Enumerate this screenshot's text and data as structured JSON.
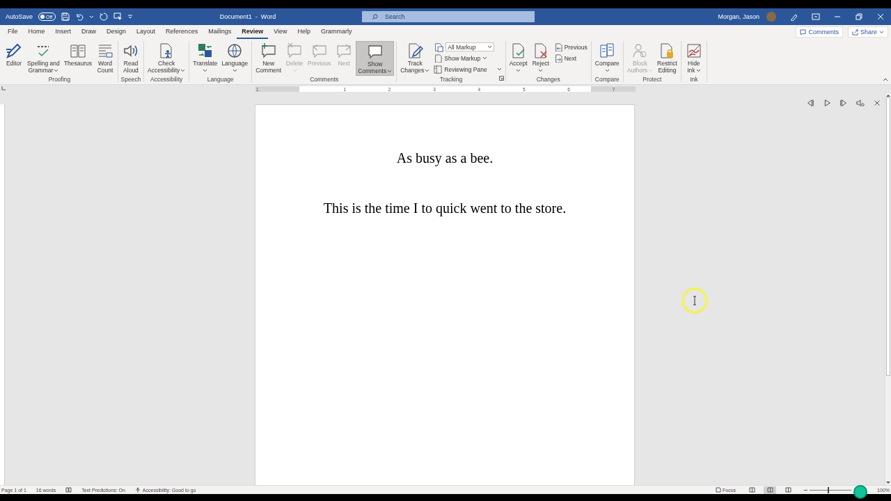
{
  "window": {
    "title": "Document1  -  Word"
  },
  "quick_access": {
    "autosave_label": "AutoSave",
    "autosave": {
      "on": false,
      "label": "Off"
    }
  },
  "search": {
    "placeholder": "Search"
  },
  "user": {
    "name": "Morgan, Jason"
  },
  "tabs": [
    {
      "label": "File",
      "selected": false
    },
    {
      "label": "Home",
      "selected": false
    },
    {
      "label": "Insert",
      "selected": false
    },
    {
      "label": "Draw",
      "selected": false
    },
    {
      "label": "Design",
      "selected": false
    },
    {
      "label": "Layout",
      "selected": false
    },
    {
      "label": "References",
      "selected": false
    },
    {
      "label": "Mailings",
      "selected": false
    },
    {
      "label": "Review",
      "selected": true
    },
    {
      "label": "View",
      "selected": false
    },
    {
      "label": "Help",
      "selected": false
    },
    {
      "label": "Grammarly",
      "selected": false
    }
  ],
  "header_buttons": [
    {
      "label": "Comments",
      "dropdown": false
    },
    {
      "label": "Share",
      "dropdown": true
    }
  ],
  "ribbon": {
    "groups": [
      {
        "name": "Proofing",
        "buttons": [
          {
            "kind": "large",
            "lines": [
              "Editor"
            ],
            "dropdown": false,
            "disabled": false,
            "pressed": false
          },
          {
            "kind": "large",
            "lines": [
              "Spelling and",
              "Grammar"
            ],
            "dropdown": true,
            "disabled": false,
            "pressed": false
          },
          {
            "kind": "large",
            "lines": [
              "Thesaurus"
            ],
            "dropdown": false,
            "disabled": false,
            "pressed": false
          },
          {
            "kind": "large",
            "lines": [
              "Word",
              "Count"
            ],
            "dropdown": false,
            "disabled": false,
            "pressed": false
          }
        ]
      },
      {
        "name": "Speech",
        "buttons": [
          {
            "kind": "large",
            "lines": [
              "Read",
              "Aloud"
            ],
            "dropdown": false,
            "disabled": false,
            "pressed": false
          }
        ]
      },
      {
        "name": "Accessibility",
        "buttons": [
          {
            "kind": "large",
            "lines": [
              "Check",
              "Accessibility"
            ],
            "dropdown": true,
            "disabled": false,
            "pressed": false
          }
        ]
      },
      {
        "name": "Language",
        "buttons": [
          {
            "kind": "large",
            "lines": [
              "Translate"
            ],
            "dropdown": true,
            "disabled": false,
            "pressed": false
          },
          {
            "kind": "large",
            "lines": [
              "Language"
            ],
            "dropdown": true,
            "disabled": false,
            "pressed": false
          }
        ]
      },
      {
        "name": "Comments",
        "buttons": [
          {
            "kind": "large",
            "lines": [
              "New",
              "Comment"
            ],
            "dropdown": false,
            "disabled": false,
            "pressed": false
          },
          {
            "kind": "large",
            "lines": [
              "Delete"
            ],
            "dropdown": true,
            "disabled": true,
            "pressed": false
          },
          {
            "kind": "large",
            "lines": [
              "Previous"
            ],
            "dropdown": false,
            "disabled": true,
            "pressed": false
          },
          {
            "kind": "large",
            "lines": [
              "Next"
            ],
            "dropdown": false,
            "disabled": true,
            "pressed": false
          },
          {
            "kind": "large",
            "lines": [
              "Show",
              "Comments"
            ],
            "dropdown": true,
            "disabled": false,
            "pressed": true
          }
        ]
      },
      {
        "name": "Tracking",
        "launcher": true,
        "buttons": [
          {
            "kind": "large",
            "lines": [
              "Track",
              "Changes"
            ],
            "dropdown": true,
            "disabled": false,
            "pressed": false
          },
          {
            "kind": "select",
            "lines": [
              "All Markup"
            ],
            "dropdown": true,
            "disabled": false,
            "pressed": false
          },
          {
            "kind": "small",
            "lines": [
              "Show Markup"
            ],
            "dropdown": true,
            "disabled": false,
            "pressed": false
          },
          {
            "kind": "small",
            "lines": [
              "Reviewing Pane"
            ],
            "dropdown": true,
            "disabled": false,
            "pressed": false
          }
        ]
      },
      {
        "name": "Changes",
        "buttons": [
          {
            "kind": "large",
            "lines": [
              "Accept"
            ],
            "dropdown": true,
            "disabled": false,
            "pressed": false
          },
          {
            "kind": "large",
            "lines": [
              "Reject"
            ],
            "dropdown": true,
            "disabled": false,
            "pressed": false
          },
          {
            "kind": "small",
            "lines": [
              "Previous"
            ],
            "dropdown": false,
            "disabled": false,
            "pressed": false
          },
          {
            "kind": "small",
            "lines": [
              "Next"
            ],
            "dropdown": false,
            "disabled": false,
            "pressed": false
          }
        ]
      },
      {
        "name": "Compare",
        "buttons": [
          {
            "kind": "large",
            "lines": [
              "Compare"
            ],
            "dropdown": true,
            "disabled": false,
            "pressed": false
          }
        ]
      },
      {
        "name": "Protect",
        "buttons": [
          {
            "kind": "large",
            "lines": [
              "Block",
              "Authors"
            ],
            "dropdown": true,
            "disabled": true,
            "pressed": false
          },
          {
            "kind": "large",
            "lines": [
              "Restrict",
              "Editing"
            ],
            "dropdown": false,
            "disabled": false,
            "pressed": false
          }
        ]
      },
      {
        "name": "Ink",
        "buttons": [
          {
            "kind": "large",
            "lines": [
              "Hide",
              "Ink"
            ],
            "dropdown": true,
            "disabled": false,
            "pressed": false
          }
        ]
      }
    ]
  },
  "ruler": {
    "numbers": [
      "1",
      "1",
      "2",
      "3",
      "4",
      "5",
      "6",
      "7"
    ]
  },
  "document": {
    "paragraphs": [
      "As busy as a bee.",
      "This is the time I to quick went to the store."
    ]
  },
  "status_bar": {
    "page": "Page 1 of 1",
    "words": "16 words",
    "text_predictions": "Text Predictions: On",
    "accessibility": "Accessibility: Good to go",
    "focus": "Focus",
    "views": [
      {
        "selected": false
      },
      {
        "selected": true
      },
      {
        "selected": false
      }
    ],
    "zoom": {
      "level": 0.45,
      "reading": "100%"
    }
  }
}
